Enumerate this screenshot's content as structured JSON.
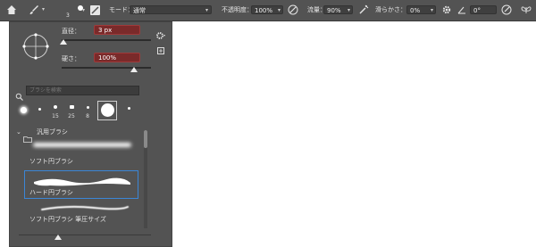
{
  "options_bar": {
    "brush_size": "3",
    "mode_label": "モード：",
    "mode_value": "通常",
    "opacity_label": "不透明度：",
    "opacity_value": "100%",
    "flow_label": "流量：",
    "flow_value": "90%",
    "smoothing_label": "滑らかさ：",
    "smoothing_value": "0%",
    "angle_value": "0°"
  },
  "panel": {
    "size_label": "直径：",
    "size_value": "3 px",
    "hardness_label": "硬さ：",
    "hardness_value": "100%",
    "search_placeholder": "ブラシを検索",
    "recent_tips": [
      {
        "num": ""
      },
      {
        "num": ""
      },
      {
        "num": "15"
      },
      {
        "num": "25"
      },
      {
        "num": "8"
      },
      {
        "num": ""
      },
      {
        "num": ""
      }
    ],
    "group_name": "汎用ブラシ",
    "presets": [
      {
        "name": "ソフト円ブラシ"
      },
      {
        "name": "ハード円ブラシ"
      },
      {
        "name": "ソフト円ブラシ 筆圧サイズ"
      }
    ]
  }
}
